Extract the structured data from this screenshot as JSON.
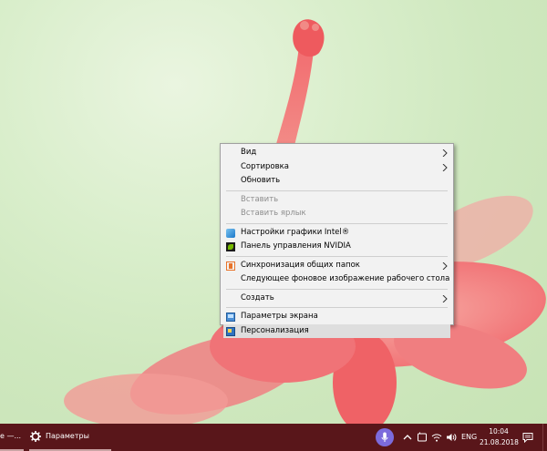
{
  "context_menu": {
    "items": [
      {
        "label": "Вид",
        "submenu": true
      },
      {
        "label": "Сортировка",
        "submenu": true
      },
      {
        "label": "Обновить"
      },
      {
        "label": "Вставить",
        "disabled": true
      },
      {
        "label": "Вставить ярлык",
        "disabled": true
      },
      {
        "label": "Настройки графики Intel®",
        "icon": "intel-graphics-icon"
      },
      {
        "label": "Панель управления NVIDIA",
        "icon": "nvidia-icon"
      },
      {
        "label": "Синхронизация общих папок",
        "icon": "sync-folders-icon",
        "submenu": true
      },
      {
        "label": "Следующее фоновое изображение рабочего стола"
      },
      {
        "label": "Создать",
        "submenu": true
      },
      {
        "label": "Параметры экрана",
        "icon": "display-settings-icon"
      },
      {
        "label": "Персонализация",
        "icon": "personalization-icon",
        "highlighted": true
      }
    ]
  },
  "taskbar": {
    "prev_window_label": "е —...",
    "settings_label": "Параметры",
    "language": "ENG",
    "time": "10:04",
    "date": "21.08.2018",
    "icons": [
      "gear-icon",
      "cortana-icon",
      "chevron-up-icon",
      "tablet-icon",
      "wifi-icon",
      "volume-icon",
      "notification-icon"
    ]
  },
  "colors": {
    "taskbar": "#59161a",
    "menu_bg": "#f2f2f2",
    "menu_highlight": "#dedede",
    "cortana": "#7c6bdc",
    "wallpaper_green": "#d9eecb",
    "flower_red": "#f26b6e"
  }
}
